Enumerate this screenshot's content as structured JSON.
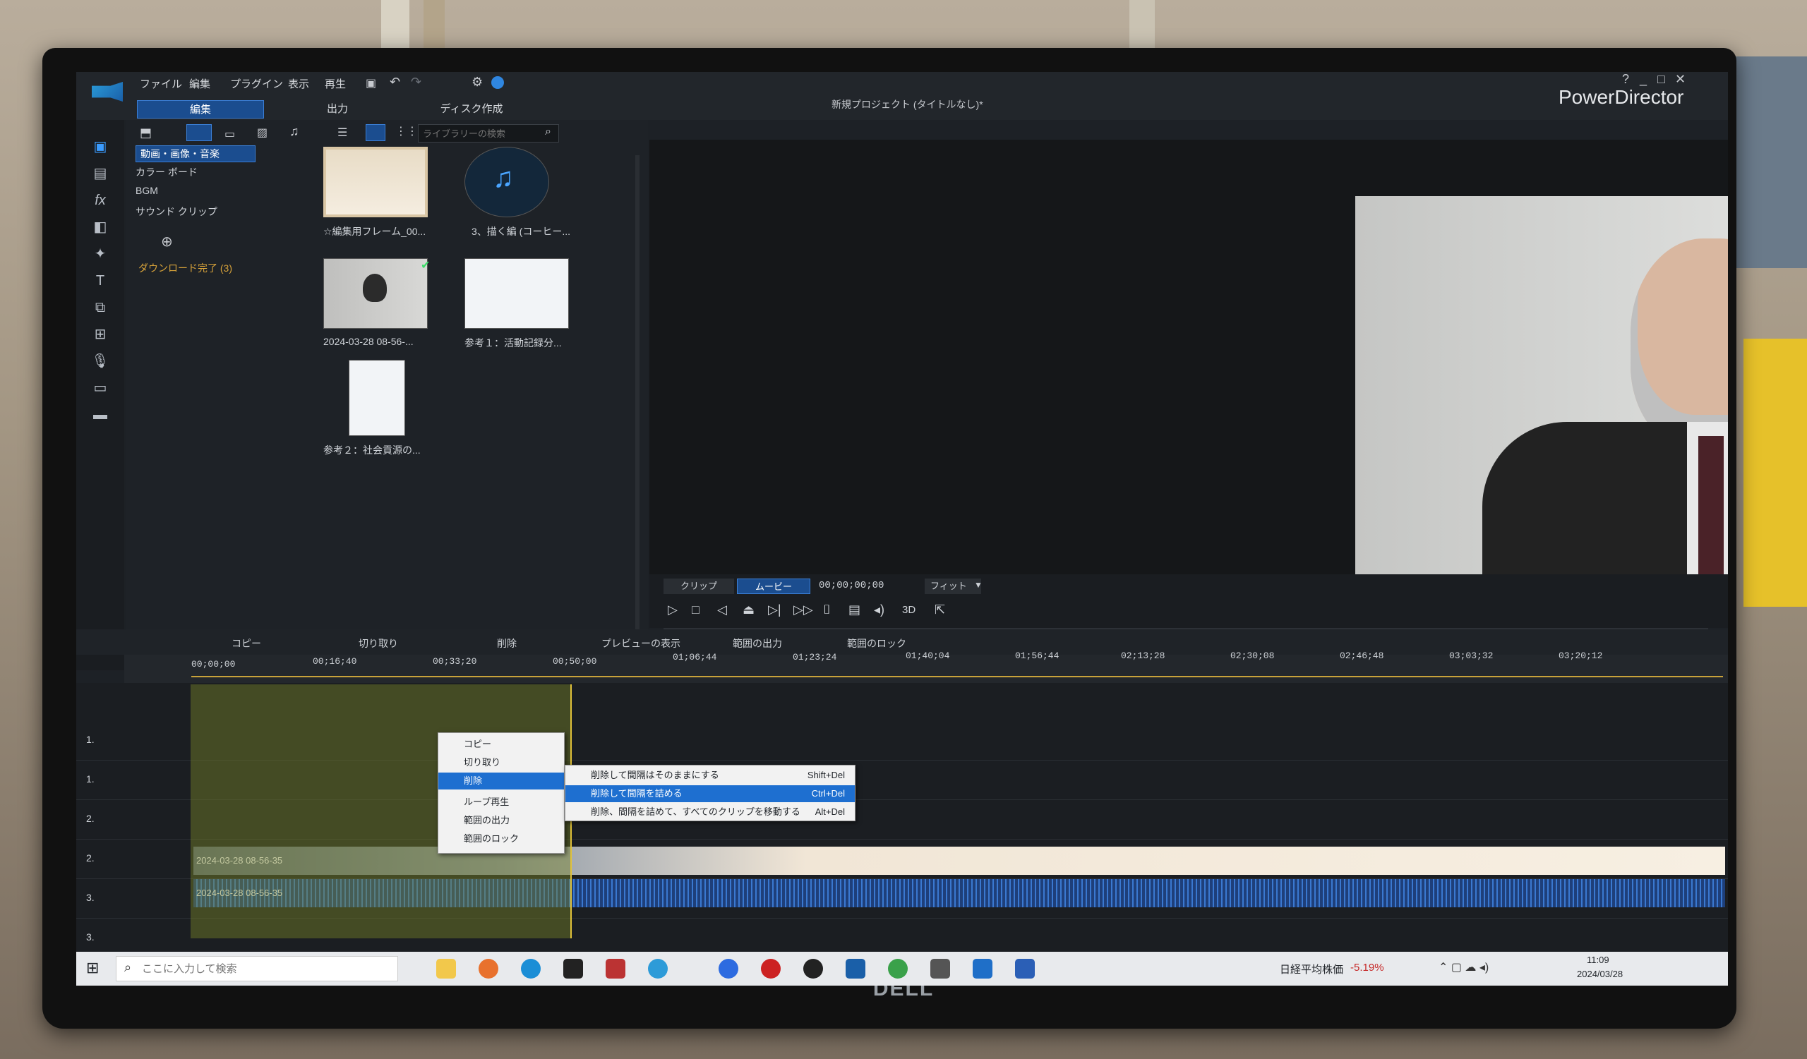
{
  "window": {
    "app_name": "PowerDirector",
    "project_title": "新規プロジェクト (タイトルなし)*",
    "menu": [
      "ファイル",
      "編集",
      "プラグイン",
      "表示",
      "再生"
    ],
    "tabs": [
      "編集",
      "出力",
      "ディスク作成"
    ],
    "active_tab": "編集",
    "controls": [
      "?",
      "_",
      "□",
      "✕"
    ]
  },
  "library": {
    "categories": [
      "動画・画像・音楽",
      "カラー ボード",
      "BGM",
      "サウンド クリップ"
    ],
    "active_category": "動画・画像・音楽",
    "download_status": "ダウンロード完了 (3)",
    "search_placeholder": "ライブラリーの検索",
    "items": [
      {
        "caption": "☆編集用フレーム_00..."
      },
      {
        "caption": "3、描く編 (コーヒー..."
      },
      {
        "caption": "2024-03-28 08-56-..."
      },
      {
        "caption": "参考１：活動記録分..."
      },
      {
        "caption": "参考２：社会貢源の..."
      }
    ]
  },
  "preview": {
    "mode_clip": "クリップ",
    "mode_movie": "ムービー",
    "timecode": "00;00;00;00",
    "fit": "フィット",
    "three_d": "3D"
  },
  "timeline": {
    "toolbar": [
      "コピー",
      "切り取り",
      "削除",
      "プレビューの表示",
      "範囲の出力",
      "範囲のロック"
    ],
    "ruler": [
      "00;00;00",
      "00;16;40",
      "00;33;20",
      "00;50;00",
      "01;06;44",
      "01;23;24",
      "01;40;04",
      "01;56;44",
      "02;13;28",
      "02;30;08",
      "02;46;48",
      "03;03;32",
      "03;20;12"
    ],
    "tracks": [
      "1.",
      "1.",
      "2.",
      "2.",
      "3.",
      "3."
    ],
    "clip_label_video": "2024-03-28 08-56-35",
    "clip_label_audio": "2024-03-28 08-56-35"
  },
  "context_menu": {
    "items": [
      "コピー",
      "切り取り",
      "削除",
      "ループ再生",
      "範囲の出力",
      "範囲のロック"
    ],
    "highlighted": "削除"
  },
  "submenu": {
    "items": [
      {
        "label": "削除して間隔はそのままにする",
        "shortcut": "Shift+Del"
      },
      {
        "label": "削除して間隔を詰める",
        "shortcut": "Ctrl+Del"
      },
      {
        "label": "削除、間隔を詰めて、すべてのクリップを移動する",
        "shortcut": "Alt+Del"
      }
    ],
    "highlighted_index": 1
  },
  "taskbar": {
    "search_placeholder": "ここに入力して検索",
    "stock_label": "日経平均株価",
    "stock_change": "-5.19%",
    "time": "11:09",
    "date": "2024/03/28"
  },
  "bezel": {
    "brand": "DELL"
  }
}
